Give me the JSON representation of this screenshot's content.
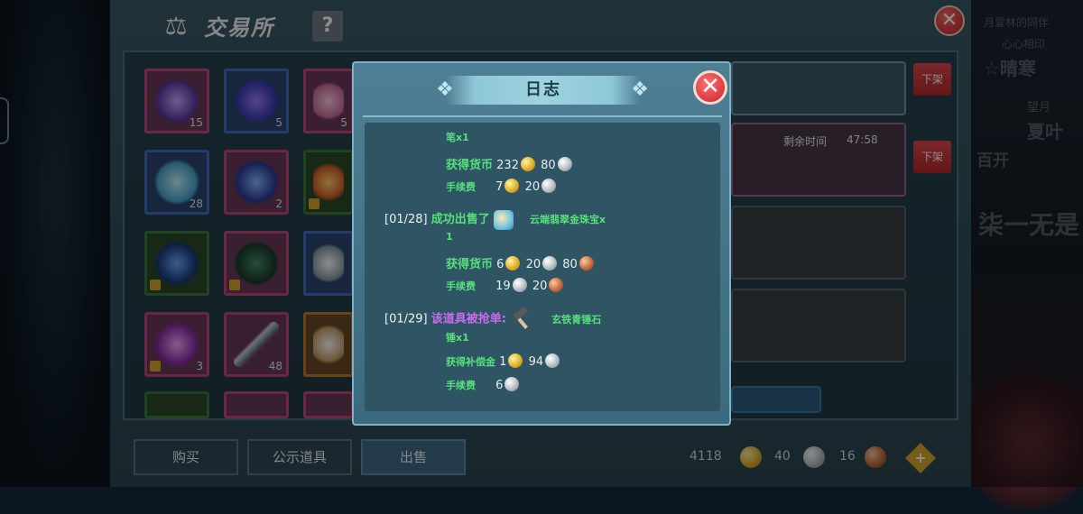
{
  "trade": {
    "title": "交易所",
    "help_label": "?",
    "close_label": "✕",
    "items": [
      {
        "name": "star-item",
        "count": "15",
        "lock": false
      },
      {
        "name": "flame-item",
        "count": "5",
        "lock": false
      },
      {
        "name": "rose-item",
        "count": "5",
        "lock": false
      },
      {
        "name": "crystal-item",
        "count": "28",
        "lock": false
      },
      {
        "name": "egg-item",
        "count": "2",
        "lock": false
      },
      {
        "name": "bonfire-item",
        "count": "",
        "lock": true
      },
      {
        "name": "beast-item",
        "count": "",
        "lock": true
      },
      {
        "name": "cauldron-item",
        "count": "",
        "lock": true
      },
      {
        "name": "disc-item",
        "count": "",
        "lock": false
      },
      {
        "name": "gem-item",
        "count": "3",
        "lock": true
      },
      {
        "name": "spear-item",
        "count": "48",
        "lock": false
      },
      {
        "name": "scroll-item",
        "count": "",
        "lock": false
      }
    ],
    "shelf_off_label": "下架",
    "remaining_time_label": "剩余时间",
    "remaining_time_value": "47:58",
    "tabs": {
      "buy": "购买",
      "public": "公示道具",
      "sell": "出售"
    },
    "currency": {
      "gold": "4118",
      "silver": "40",
      "bronze": "16",
      "add_label": "+"
    }
  },
  "background_text": {
    "r1": "月爱林的同伴",
    "r2": "心心相印",
    "r3": "☆晴寒",
    "r4": "望月",
    "r5": "夏叶",
    "r6": "百开",
    "r7": "柒一无是"
  },
  "log": {
    "title": "日志",
    "close_label": "✕",
    "entries": [
      {
        "cont": "笔x1",
        "gain_label": "获得货币",
        "gain": {
          "gold": "232",
          "silver": "80"
        },
        "fee_label": "手续费",
        "fee": {
          "gold": "7",
          "silver": "20"
        }
      },
      {
        "date": "[01/28]",
        "action": "成功出售了",
        "item": "云端翡翠金珠宝x",
        "count": "1",
        "gain_label": "获得货币",
        "gain": {
          "gold": "6",
          "silver": "20",
          "bronze": "80"
        },
        "fee_label": "手续费",
        "fee": {
          "silver": "19",
          "bronze": "20"
        }
      },
      {
        "date": "[01/29]",
        "action": "该道具被抢单:",
        "item": "玄铁青锤石",
        "count": "锤x1",
        "gain_label": "获得补偿金",
        "gain": {
          "gold": "1",
          "silver": "94"
        },
        "fee_label": "手续费",
        "fee": {
          "silver": "6"
        }
      }
    ]
  }
}
